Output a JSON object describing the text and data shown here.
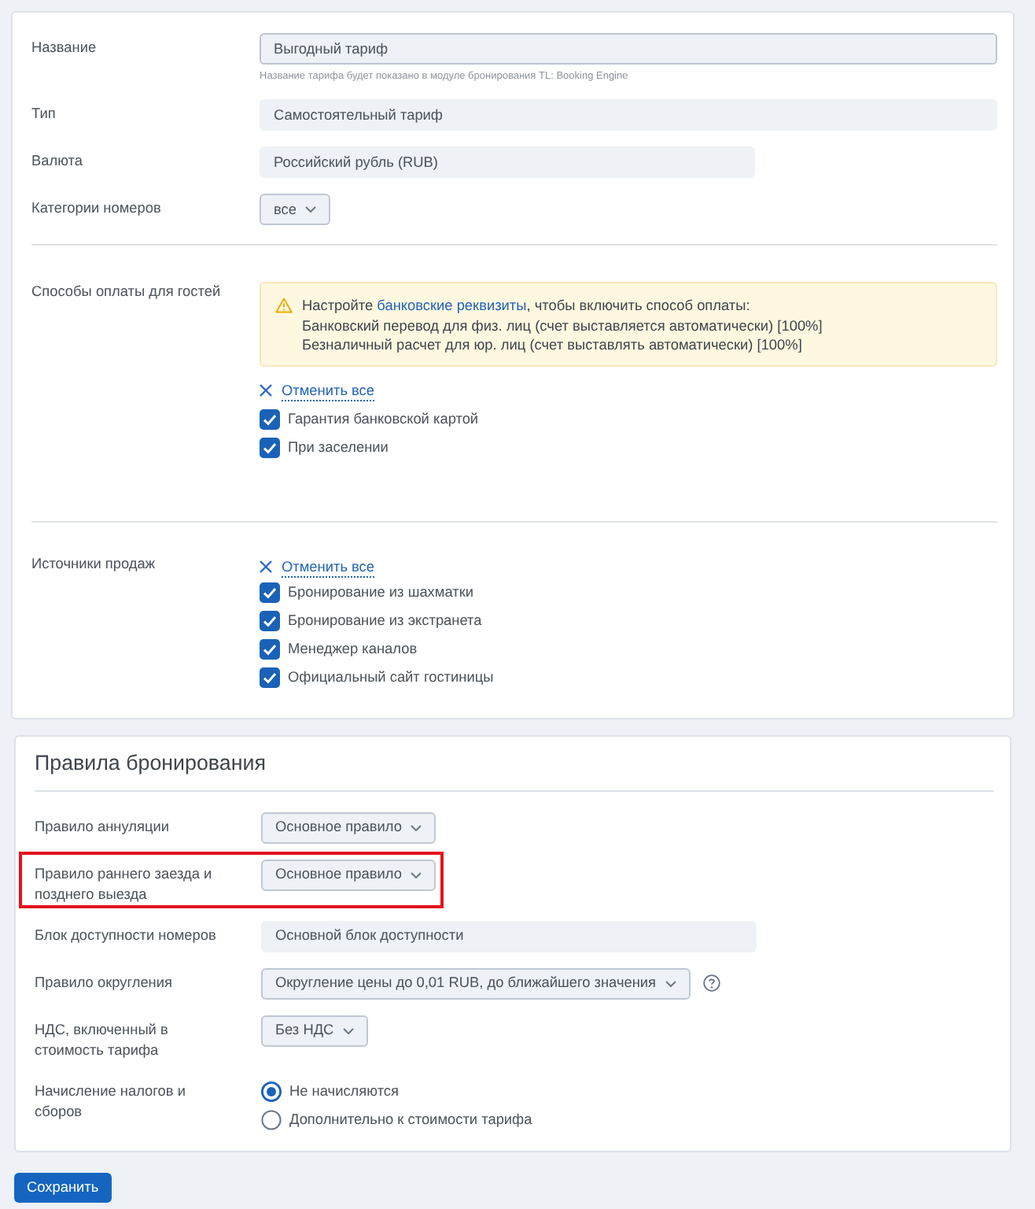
{
  "general": {
    "rows": [
      {
        "kind": "input",
        "label": "Название",
        "value": "Выгодный тариф",
        "hint": "Название тарифа будет показано в модуле бронирования TL: Booking Engine"
      },
      {
        "kind": "static",
        "label": "Тип",
        "value": "Самостоятельный тариф"
      },
      {
        "kind": "static",
        "label": "Валюта",
        "value": "Российский рубль (RUB)"
      },
      {
        "kind": "select",
        "label": "Категории номеров",
        "value": "все"
      }
    ]
  },
  "payment": {
    "label": "Способы оплаты для гостей",
    "alert": {
      "before": "Настройте ",
      "link": "банковские реквизиты",
      "after": ", чтобы включить способ оплаты:",
      "lines": [
        "Банковский перевод для физ. лиц (счет выставляется автоматически) [100%]",
        "Безналичный расчет для юр. лиц (счет выставлять автоматически) [100%]"
      ]
    },
    "clear_all": "Отменить все",
    "options": [
      {
        "label": "Гарантия банковской картой",
        "checked": true
      },
      {
        "label": "При заселении",
        "checked": true
      }
    ]
  },
  "sources": {
    "label": "Источники продаж",
    "clear_all": "Отменить все",
    "options": [
      {
        "label": "Бронирование из шахматки",
        "checked": true
      },
      {
        "label": "Бронирование из экстранета",
        "checked": true
      },
      {
        "label": "Менеджер каналов",
        "checked": true
      },
      {
        "label": "Официальный сайт гостиницы",
        "checked": true
      }
    ]
  },
  "booking_rules": {
    "title": "Правила бронирования",
    "rows": [
      {
        "kind": "select",
        "label": "Правило аннуляции",
        "value": "Основное правило",
        "highlighted": false
      },
      {
        "kind": "select",
        "label": "Правило раннего заезда и позднего выезда",
        "value": "Основное правило",
        "highlighted": true
      },
      {
        "kind": "static",
        "label": "Блок доступности номеров",
        "value": "Основной блок доступности",
        "highlighted": false
      },
      {
        "kind": "select",
        "label": "Правило округления",
        "value": "Округление цены до 0,01 RUB, до ближайшего значения",
        "help": true,
        "highlighted": false
      },
      {
        "kind": "select",
        "label": "НДС, включенный в стоимость тарифа",
        "value": "Без НДС",
        "highlighted": false
      },
      {
        "kind": "radio",
        "label": "Начисление налогов и сборов",
        "options": [
          {
            "label": "Не начисляются",
            "selected": true
          },
          {
            "label": "Дополнительно к стоимости тарифа",
            "selected": false
          }
        ],
        "highlighted": false
      }
    ]
  },
  "save_button": "Сохранить"
}
